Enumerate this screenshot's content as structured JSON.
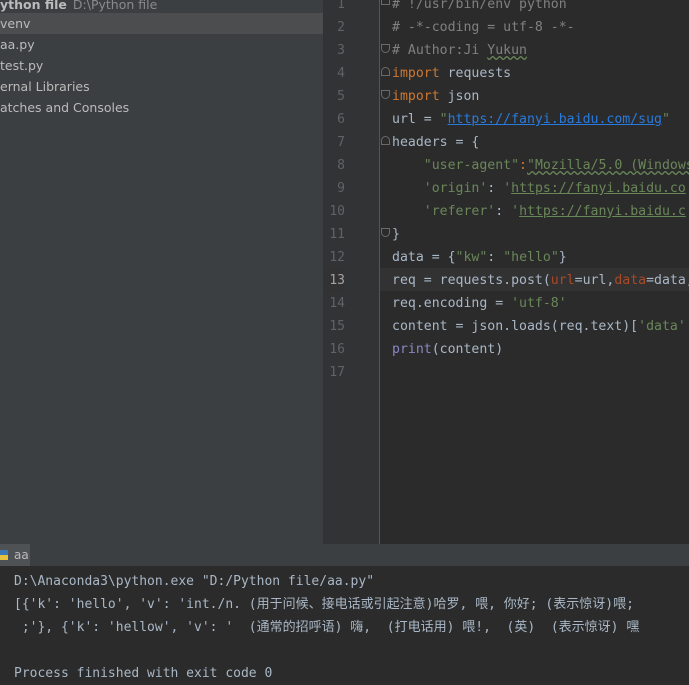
{
  "project": {
    "root_name": "ython file",
    "root_path": "D:\\Python file",
    "items": [
      "venv",
      "aa.py",
      "test.py",
      "ernal Libraries",
      "atches and Consoles"
    ]
  },
  "editor": {
    "line_numbers": [
      "1",
      "2",
      "3",
      "4",
      "5",
      "6",
      "7",
      "8",
      "9",
      "10",
      "11",
      "12",
      "13",
      "14",
      "15",
      "16",
      "17"
    ],
    "current_line": "13",
    "code": {
      "l1": "# !/usr/bin/env python",
      "l2": "# -*-coding = utf-8 -*-",
      "l3a": "# Author:Ji ",
      "l3b": "Yukun",
      "l4a": "import",
      "l4b": " requests",
      "l5a": "import",
      "l5b": " json",
      "l6a": "url = ",
      "l6b": "\"",
      "l6c": "https://fanyi.baidu.com/sug",
      "l6d": "\"",
      "l7": "headers = {",
      "l8a": "    ",
      "l8b": "\"user-agent\"",
      "l8c": ":",
      "l8d": "\"Mozilla/5.0 (Windows",
      "l9a": "    ",
      "l9b": "'origin'",
      "l9c": ": ",
      "l9d": "'",
      "l9e": "https://fanyi.baidu.co",
      "l10a": "    ",
      "l10b": "'referer'",
      "l10c": ": ",
      "l10d": "'",
      "l10e": "https://fanyi.baidu.c",
      "l11": "}",
      "l12a": "data = {",
      "l12b": "\"kw\"",
      "l12c": ": ",
      "l12d": "\"hello\"",
      "l12e": "}",
      "l13a": "req = requests.post(",
      "l13b": "url",
      "l13c": "=url,",
      "l13d": "data",
      "l13e": "=data,",
      "l14a": "req.encoding = ",
      "l14b": "'utf-8'",
      "l15a": "content = json.loads(req.text)[",
      "l15b": "'data'",
      "l16a": "print",
      "l16b": "(content)"
    }
  },
  "run": {
    "tab_label": "aa",
    "icon": "python-run-icon"
  },
  "console": {
    "lines": [
      "D:\\Anaconda3\\python.exe \"D:/Python file/aa.py\"",
      "[{'k': 'hello', 'v': 'int./n. (用于问候、接电话或引起注意)哈罗, 喂, 你好; (表示惊讶)喂;",
      " ;'}, {'k': 'hellow', 'v': '  (通常的招呼语) 嗨,  (打电话用) 喂!,  (英)  (表示惊讶) 嘿",
      "",
      "Process finished with exit code 0"
    ]
  },
  "colors": {
    "keyword": "#cc7832",
    "string": "#6a8759",
    "comment": "#808080",
    "link": "#287bde",
    "default_text": "#a9b7c6",
    "param": "#aa4926",
    "builtin": "#8888c6"
  }
}
